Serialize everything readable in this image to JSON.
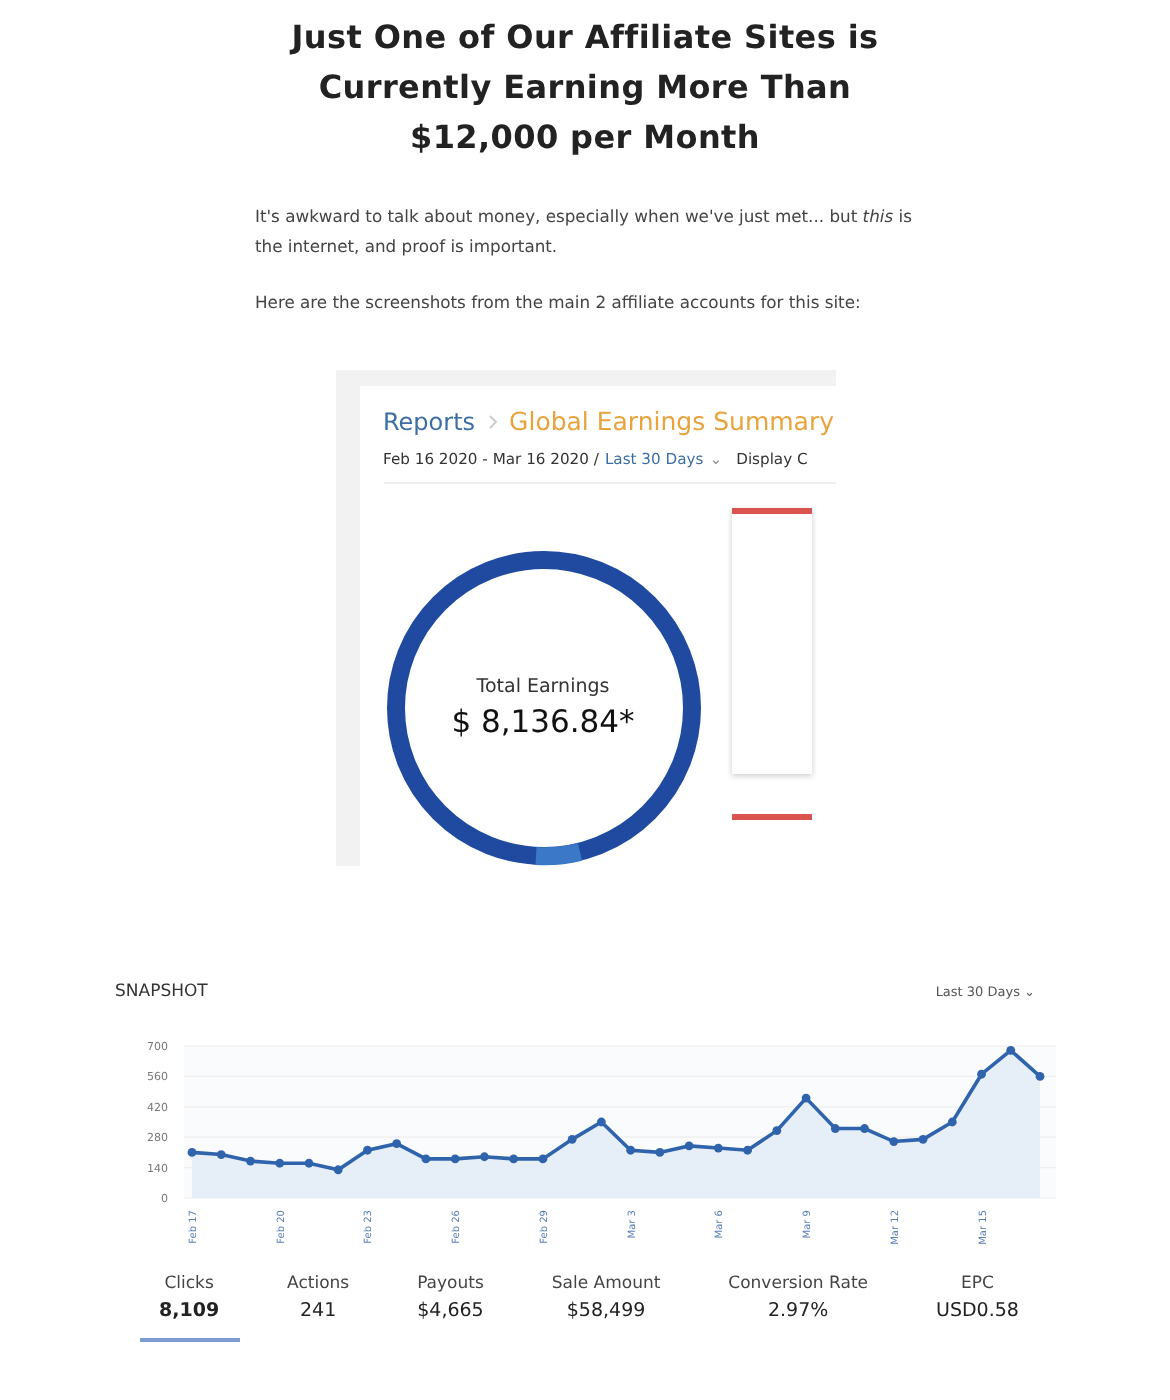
{
  "heading": "Just One of Our Affiliate Sites is Currently Earning More Than $12,000 per Month",
  "paragraphs": [
    "It's awkward to talk about money, especially when we've just met... but *this* is the internet, and proof is important.",
    "Here are the screenshots from the main 2 affiliate accounts for this site:"
  ],
  "earnings_report": {
    "breadcrumb": [
      "Reports",
      "Global Earnings Summary"
    ],
    "date_range": "Feb 16 2020 - Mar 16 2020 /",
    "period": "Last 30 Days",
    "period_caret": "⌄",
    "display": "Display C",
    "total_label": "Total Earnings",
    "total_value": "$ 8,136.84*"
  },
  "snapshot": {
    "title": "SNAPSHOT",
    "period": "Last 30 Days ⌄",
    "chart_data": {
      "type": "area",
      "categories": [
        "Feb 17",
        null,
        null,
        "Feb 20",
        null,
        null,
        "Feb 23",
        null,
        null,
        "Feb 26",
        null,
        null,
        "Feb 29",
        null,
        null,
        "Mar 3",
        null,
        null,
        "Mar 6",
        null,
        null,
        "Mar 9",
        null,
        null,
        "Mar 12",
        null,
        null,
        "Mar 15",
        null,
        null
      ],
      "series": [
        {
          "color": "#2f64ad",
          "values": [
            210,
            200,
            170,
            160,
            160,
            130,
            220,
            250,
            180,
            180,
            190,
            180,
            180,
            270,
            350,
            220,
            210,
            240,
            230,
            220,
            310,
            460,
            320,
            320,
            260,
            270,
            350,
            570,
            680,
            560
          ]
        }
      ],
      "ylim": [
        0,
        700
      ],
      "yticks": [
        0,
        140,
        280,
        420,
        560,
        700
      ],
      "grid": true
    },
    "stats": [
      {
        "label": "Clicks",
        "value": "8,109",
        "selected": true
      },
      {
        "label": "Actions",
        "value": "241",
        "selected": false
      },
      {
        "label": "Payouts",
        "value": "$4,665",
        "selected": false
      },
      {
        "label": "Sale Amount",
        "value": "$58,499",
        "selected": false
      },
      {
        "label": "Conversion Rate",
        "value": "2.97%",
        "selected": false
      },
      {
        "label": "EPC",
        "value": "USD0.58",
        "selected": false
      }
    ]
  }
}
